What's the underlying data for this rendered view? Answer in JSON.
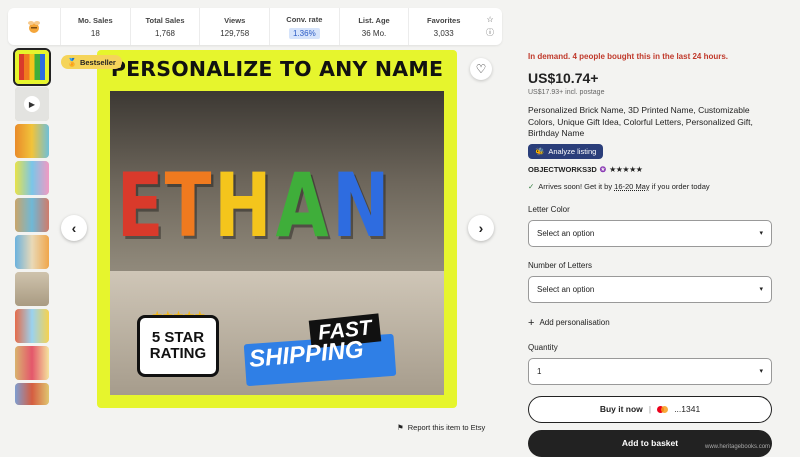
{
  "stats": {
    "items": [
      {
        "label": "Mo. Sales",
        "value": "18"
      },
      {
        "label": "Total Sales",
        "value": "1,768"
      },
      {
        "label": "Views",
        "value": "129,758"
      },
      {
        "label": "Conv. rate",
        "value": "1.36%"
      },
      {
        "label": "List. Age",
        "value": "36 Mo."
      },
      {
        "label": "Favorites",
        "value": "3,033"
      }
    ]
  },
  "gallery": {
    "badge": "Bestseller",
    "headline": "PERSONALIZE TO ANY NAME",
    "letters": [
      "E",
      "T",
      "H",
      "A",
      "N"
    ],
    "letter_colors": [
      "#d93a2b",
      "#f07a1f",
      "#f4c51c",
      "#3fae3a",
      "#2e6ce0"
    ],
    "rating_badge_line1": "5 STAR",
    "rating_badge_line2": "RATING",
    "fast": "FAST",
    "shipping": "SHIPPING",
    "report": "Report this item to Etsy"
  },
  "listing": {
    "demand": "In demand. 4 people bought this in the last 24 hours.",
    "price": "US$10.74+",
    "postage": "US$17.93+ incl. postage",
    "title": "Personalized Brick Name, 3D Printed Name, Customizable Colors, Unique Gift Idea, Colorful Letters, Personalized Gift, Birthday Name",
    "analyze": "Analyze listing",
    "shop": "OBJECTWORKS3D",
    "stars": "★★★★★",
    "arrives_pre": "Arrives soon! Get it by",
    "arrives_date": "16-20 May",
    "arrives_post": "if you order today",
    "letter_color_label": "Letter Color",
    "letter_color_value": "Select an option",
    "num_letters_label": "Number of Letters",
    "num_letters_value": "Select an option",
    "add_personalisation": "Add personalisation",
    "quantity_label": "Quantity",
    "quantity_value": "1",
    "buy_now": "Buy it now",
    "card_last": "...1341",
    "add_to_basket": "Add to basket"
  },
  "watermark": "www.heritagebooks.com"
}
